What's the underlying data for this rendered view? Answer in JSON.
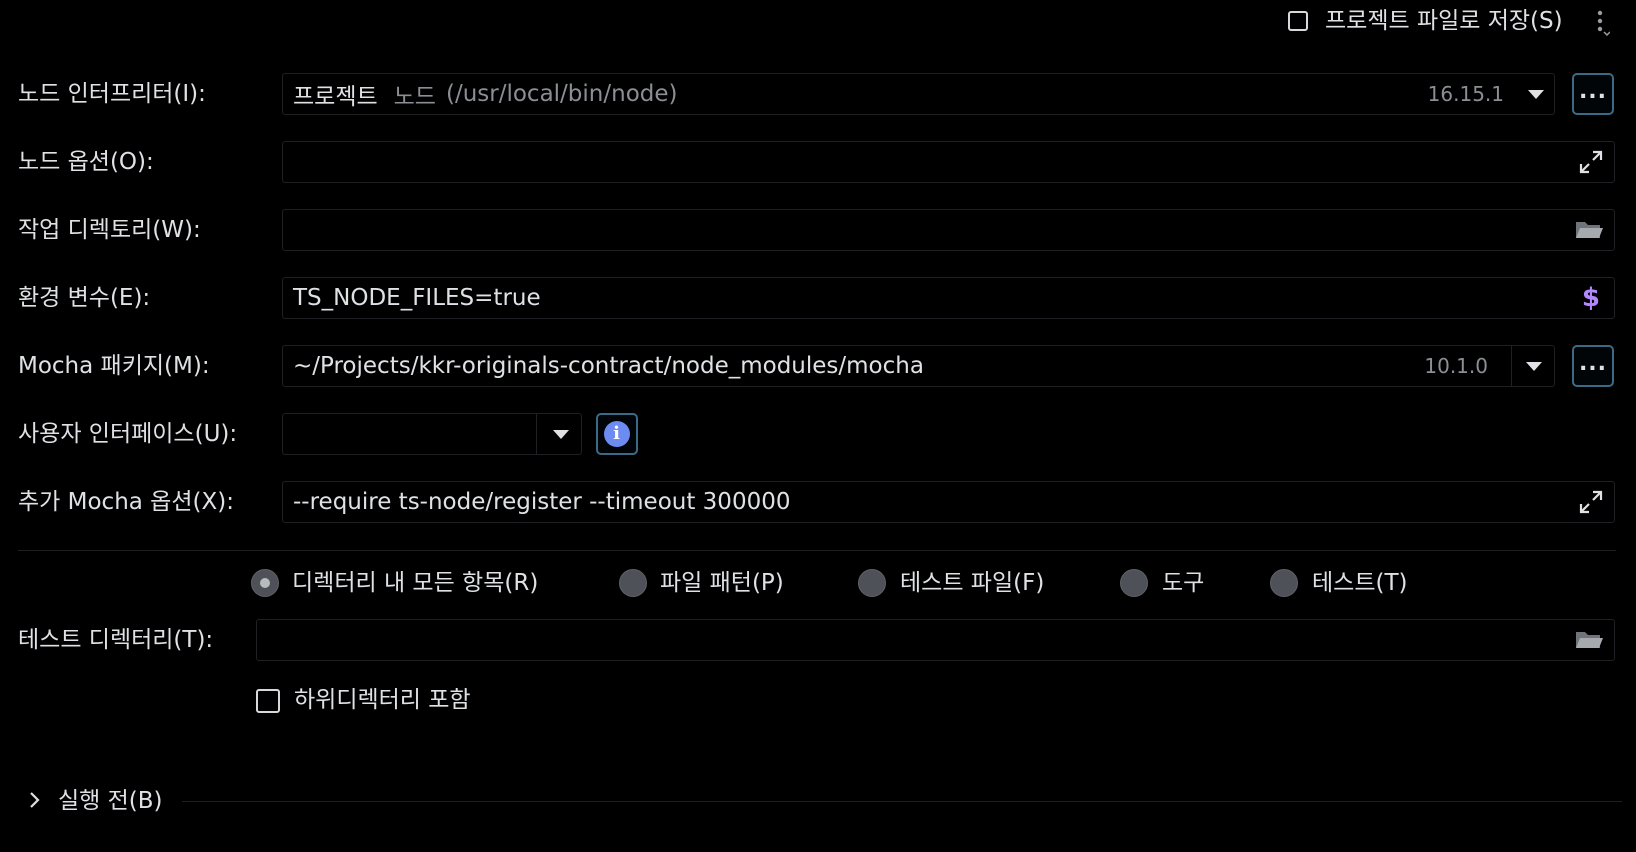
{
  "header": {
    "save_to_project_file": "프로젝트 파일로 저장(S)",
    "more_icon": "vertical-ellipsis-icon"
  },
  "node_interpreter": {
    "label": "노드 인터프리터(I):",
    "prefix": "프로젝트",
    "name": "노드",
    "path": "(/usr/local/bin/node)",
    "version": "16.15.1",
    "browse": "..."
  },
  "node_options": {
    "label": "노드 옵션(O):",
    "value": ""
  },
  "working_dir": {
    "label": "작업 디렉토리(W):",
    "value": ""
  },
  "env_vars": {
    "label": "환경 변수(E):",
    "value": "TS_NODE_FILES=true",
    "icon_char": "$"
  },
  "mocha_package": {
    "label": "Mocha 패키지(M):",
    "value": "~/Projects/kkr-originals-contract/node_modules/mocha",
    "version": "10.1.0",
    "browse": "..."
  },
  "user_interface": {
    "label": "사용자 인터페이스(U):",
    "value": "",
    "info_char": "i"
  },
  "extra_mocha_options": {
    "label": "추가 Mocha 옵션(X):",
    "value": "--require ts-node/register --timeout 300000"
  },
  "test_scope": {
    "options": [
      {
        "label": "디렉터리 내 모든 항목(R)",
        "selected": true
      },
      {
        "label": "파일 패턴(P)",
        "selected": false
      },
      {
        "label": "테스트 파일(F)",
        "selected": false
      },
      {
        "label": "도구",
        "selected": false
      },
      {
        "label": "테스트(T)",
        "selected": false
      }
    ]
  },
  "test_directory": {
    "label": "테스트 디렉터리(T):",
    "value": ""
  },
  "include_subdirs": {
    "label": "하위디렉터리 포함",
    "checked": false
  },
  "before_launch": {
    "label": "실행 전(B)"
  },
  "colors": {
    "background": "#000000",
    "text": "#dfe1e5",
    "muted": "#8b8e94",
    "accent_border": "#3b6a86",
    "dollar": "#b388ff",
    "info": "#6d8cf2"
  }
}
